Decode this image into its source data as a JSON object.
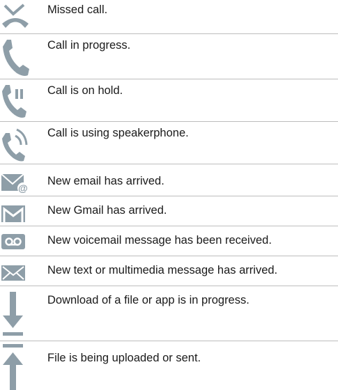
{
  "icon_color": "#8e9ea8",
  "rows": [
    {
      "icon": "missed-call-icon",
      "text": "Missed call."
    },
    {
      "icon": "call-in-progress-icon",
      "text": "Call in progress."
    },
    {
      "icon": "call-on-hold-icon",
      "text": "Call is on hold."
    },
    {
      "icon": "speakerphone-icon",
      "text": "Call is using speakerphone."
    },
    {
      "icon": "new-email-icon",
      "text": "New email has arrived."
    },
    {
      "icon": "gmail-icon",
      "text": "New Gmail has arrived."
    },
    {
      "icon": "voicemail-icon",
      "text": "New voicemail message has been received."
    },
    {
      "icon": "new-message-icon",
      "text": "New text or multimedia message has arrived."
    },
    {
      "icon": "download-icon",
      "text": "Download of a file or app is in progress."
    },
    {
      "icon": "upload-icon",
      "text": "File is being uploaded or sent."
    }
  ]
}
